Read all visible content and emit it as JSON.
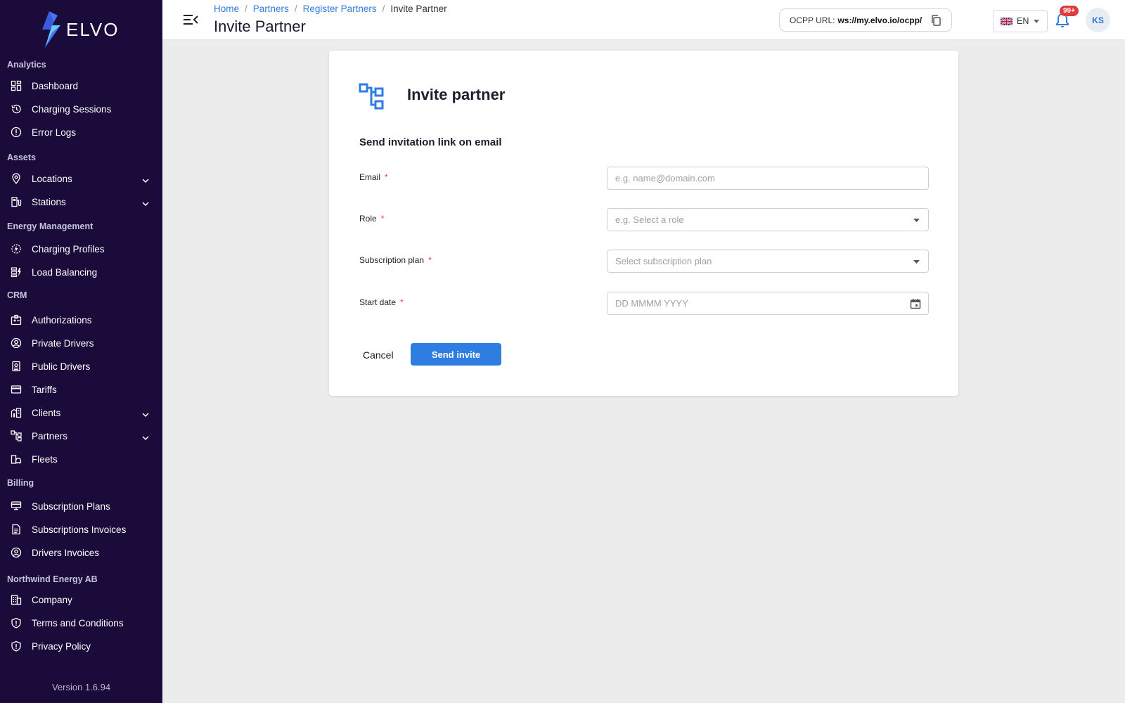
{
  "brand": {
    "name": "ELVO"
  },
  "sidebar": {
    "sections": [
      {
        "title": "Analytics",
        "items": [
          {
            "label": "Dashboard",
            "icon": "dashboard-icon"
          },
          {
            "label": "Charging Sessions",
            "icon": "history-icon"
          },
          {
            "label": "Error Logs",
            "icon": "alert-icon"
          }
        ]
      },
      {
        "title": "Assets",
        "items": [
          {
            "label": "Locations",
            "icon": "location-pin-icon",
            "expandable": true
          },
          {
            "label": "Stations",
            "icon": "station-icon",
            "expandable": true
          }
        ]
      },
      {
        "title": "Energy Management",
        "items": [
          {
            "label": "Charging Profiles",
            "icon": "charging-profile-icon"
          },
          {
            "label": "Load Balancing",
            "icon": "load-balancing-icon"
          }
        ]
      },
      {
        "title": "CRM",
        "items": [
          {
            "label": "Authorizations",
            "icon": "authorization-icon"
          },
          {
            "label": "Private Drivers",
            "icon": "user-circle-icon"
          },
          {
            "label": "Public Drivers",
            "icon": "badge-icon"
          },
          {
            "label": "Tariffs",
            "icon": "card-icon"
          },
          {
            "label": "Clients",
            "icon": "clients-icon",
            "expandable": true
          },
          {
            "label": "Partners",
            "icon": "partners-icon",
            "expandable": true
          },
          {
            "label": "Fleets",
            "icon": "fleet-icon"
          }
        ]
      },
      {
        "title": "Billing",
        "items": [
          {
            "label": "Subscription Plans",
            "icon": "subscription-icon"
          },
          {
            "label": "Subscriptions Invoices",
            "icon": "invoice-icon"
          },
          {
            "label": "Drivers Invoices",
            "icon": "user-circle-icon"
          }
        ]
      },
      {
        "title": "Northwind Energy AB",
        "items": [
          {
            "label": "Company",
            "icon": "company-icon"
          },
          {
            "label": "Terms and Conditions",
            "icon": "shield-icon"
          },
          {
            "label": "Privacy Policy",
            "icon": "shield-icon"
          }
        ]
      }
    ],
    "version": "Version 1.6.94"
  },
  "header": {
    "breadcrumb": [
      "Home",
      "Partners",
      "Register Partners",
      "Invite Partner"
    ],
    "title": "Invite Partner",
    "ocpp_label": "OCPP URL:",
    "ocpp_value": "ws://my.elvo.io/ocpp/",
    "language": "EN",
    "notifications_badge": "99+",
    "avatar_initials": "KS"
  },
  "form": {
    "title": "Invite partner",
    "subtitle": "Send invitation link on email",
    "required_mark": "*",
    "fields": {
      "email": {
        "label": "Email",
        "placeholder": "e.g. name@domain.com"
      },
      "role": {
        "label": "Role",
        "placeholder": "e.g. Select a role"
      },
      "plan": {
        "label": "Subscription plan",
        "placeholder": "Select subscription plan"
      },
      "start_date": {
        "label": "Start date",
        "placeholder": "DD MMMM YYYY"
      }
    },
    "cancel_label": "Cancel",
    "submit_label": "Send invite"
  },
  "colors": {
    "sidebar_bg": "#1a0b3b",
    "accent": "#2f7de1",
    "badge": "#e23b3b",
    "required": "#e04545"
  }
}
